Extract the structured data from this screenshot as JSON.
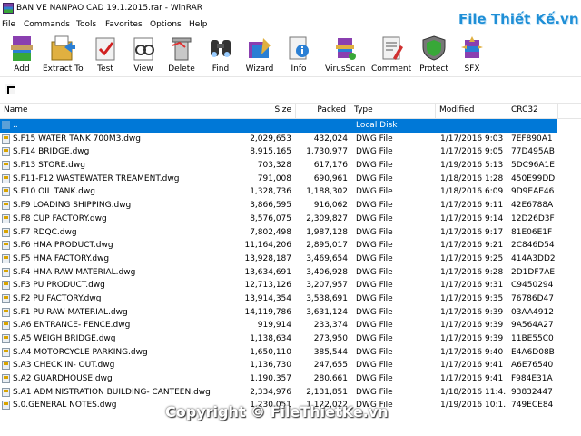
{
  "window": {
    "title": "BAN VE NANPAO CAD 19.1.2015.rar - WinRAR"
  },
  "watermark": {
    "logo": "File Thiết Kế.vn",
    "copyright": "Copyright © FileThietKe.vn"
  },
  "menu": [
    "File",
    "Commands",
    "Tools",
    "Favorites",
    "Options",
    "Help"
  ],
  "toolbar": {
    "add": "Add",
    "extract": "Extract To",
    "test": "Test",
    "view": "View",
    "delete": "Delete",
    "find": "Find",
    "wizard": "Wizard",
    "info": "Info",
    "virusscan": "VirusScan",
    "comment": "Comment",
    "protect": "Protect",
    "sfx": "SFX"
  },
  "columns": {
    "name": "Name",
    "size": "Size",
    "packed": "Packed",
    "type": "Type",
    "modified": "Modified",
    "crc": "CRC32"
  },
  "parent_row": {
    "name": "..",
    "type": "Local Disk"
  },
  "files": [
    {
      "name": "S.F15 WATER TANK 700M3.dwg",
      "size": "2,029,653",
      "packed": "432,024",
      "type": "DWG File",
      "modified": "1/17/2016 9:03 ...",
      "crc": "7EF890A1"
    },
    {
      "name": "S.F14 BRIDGE.dwg",
      "size": "8,915,165",
      "packed": "1,730,977",
      "type": "DWG File",
      "modified": "1/17/2016 9:05 ...",
      "crc": "77D495AB"
    },
    {
      "name": "S.F13 STORE.dwg",
      "size": "703,328",
      "packed": "617,176",
      "type": "DWG File",
      "modified": "1/19/2016 5:13 ...",
      "crc": "5DC96A1E"
    },
    {
      "name": "S.F11-F12 WASTEWATER TREAMENT.dwg",
      "size": "791,008",
      "packed": "690,961",
      "type": "DWG File",
      "modified": "1/18/2016 1:28 ...",
      "crc": "450E99DD"
    },
    {
      "name": "S.F10 OIL TANK.dwg",
      "size": "1,328,736",
      "packed": "1,188,302",
      "type": "DWG File",
      "modified": "1/18/2016 6:09 ...",
      "crc": "9D9EAE46"
    },
    {
      "name": "S.F9 LOADING SHIPPING.dwg",
      "size": "3,866,595",
      "packed": "916,062",
      "type": "DWG File",
      "modified": "1/17/2016 9:11 ...",
      "crc": "42E6788A"
    },
    {
      "name": "S.F8 CUP FACTORY.dwg",
      "size": "8,576,075",
      "packed": "2,309,827",
      "type": "DWG File",
      "modified": "1/17/2016 9:14 ...",
      "crc": "12D26D3F"
    },
    {
      "name": "S.F7 RDQC.dwg",
      "size": "7,802,498",
      "packed": "1,987,128",
      "type": "DWG File",
      "modified": "1/17/2016 9:17 ...",
      "crc": "81E06E1F"
    },
    {
      "name": "S.F6 HMA PRODUCT.dwg",
      "size": "11,164,206",
      "packed": "2,895,017",
      "type": "DWG File",
      "modified": "1/17/2016 9:21 ...",
      "crc": "2C846D54"
    },
    {
      "name": "S.F5 HMA FACTORY.dwg",
      "size": "13,928,187",
      "packed": "3,469,654",
      "type": "DWG File",
      "modified": "1/17/2016 9:25 ...",
      "crc": "414A3DD2"
    },
    {
      "name": "S.F4 HMA RAW MATERIAL.dwg",
      "size": "13,634,691",
      "packed": "3,406,928",
      "type": "DWG File",
      "modified": "1/17/2016 9:28 ...",
      "crc": "2D1DF7AE"
    },
    {
      "name": "S.F3 PU PRODUCT.dwg",
      "size": "12,713,126",
      "packed": "3,207,957",
      "type": "DWG File",
      "modified": "1/17/2016 9:31 ...",
      "crc": "C9450294"
    },
    {
      "name": "S.F2 PU FACTORY.dwg",
      "size": "13,914,354",
      "packed": "3,538,691",
      "type": "DWG File",
      "modified": "1/17/2016 9:35 ...",
      "crc": "76786D47"
    },
    {
      "name": "S.F1 PU RAW MATERIAL.dwg",
      "size": "14,119,786",
      "packed": "3,631,124",
      "type": "DWG File",
      "modified": "1/17/2016 9:39 ...",
      "crc": "03AA4912"
    },
    {
      "name": "S.A6 ENTRANCE-  FENCE.dwg",
      "size": "919,914",
      "packed": "233,374",
      "type": "DWG File",
      "modified": "1/17/2016 9:39 ...",
      "crc": "9A564A27"
    },
    {
      "name": "S.A5 WEIGH BRIDGE.dwg",
      "size": "1,138,634",
      "packed": "273,950",
      "type": "DWG File",
      "modified": "1/17/2016 9:39 ...",
      "crc": "11BE55C0"
    },
    {
      "name": "S.A4 MOTORCYCLE PARKING.dwg",
      "size": "1,650,110",
      "packed": "385,544",
      "type": "DWG File",
      "modified": "1/17/2016 9:40 ...",
      "crc": "E4A6D08B"
    },
    {
      "name": "S.A3 CHECK IN- OUT.dwg",
      "size": "1,136,730",
      "packed": "247,655",
      "type": "DWG File",
      "modified": "1/17/2016 9:41 ...",
      "crc": "A6E76540"
    },
    {
      "name": "S.A2 GUARDHOUSE.dwg",
      "size": "1,190,357",
      "packed": "280,661",
      "type": "DWG File",
      "modified": "1/17/2016 9:41 ...",
      "crc": "F984E31A"
    },
    {
      "name": "S.A1 ADMINISTRATION BUILDING- CANTEEN.dwg",
      "size": "2,334,976",
      "packed": "2,131,851",
      "type": "DWG File",
      "modified": "1/18/2016 11:4...",
      "crc": "93832447"
    },
    {
      "name": "S.0.GENERAL NOTES.dwg",
      "size": "1,230,051",
      "packed": "1,122,022",
      "type": "DWG File",
      "modified": "1/19/2016 10:1...",
      "crc": "749ECE84"
    }
  ]
}
